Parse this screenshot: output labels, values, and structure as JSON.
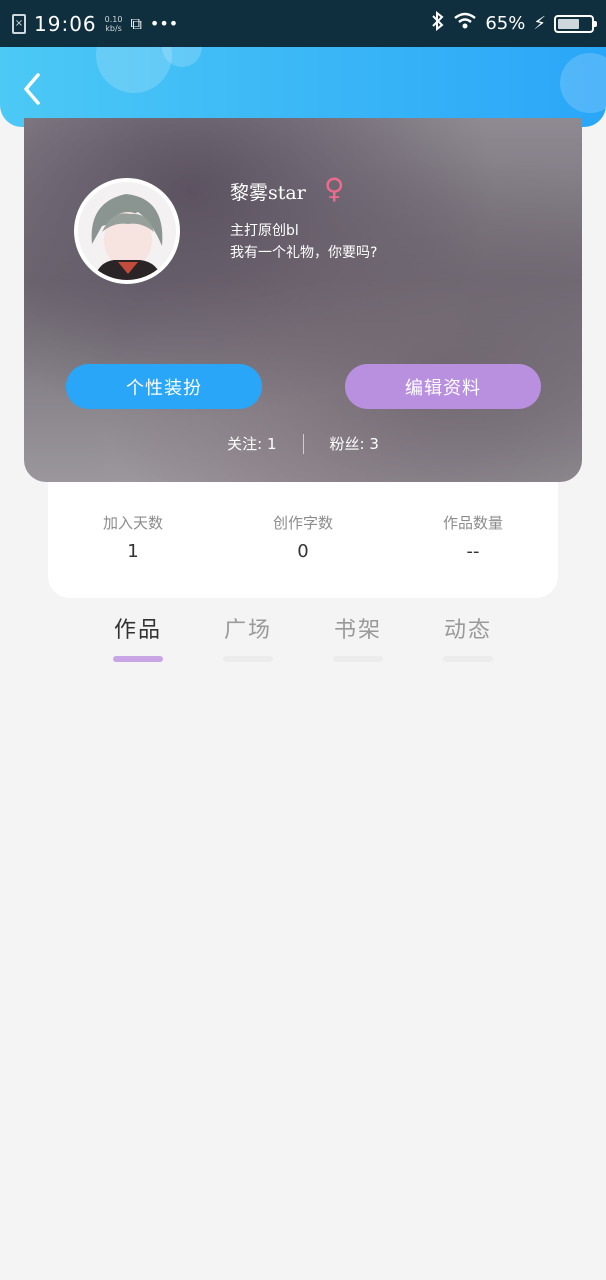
{
  "status_bar": {
    "time": "19:06",
    "speed_value": "0.10",
    "speed_unit": "kb/s",
    "battery": "65%",
    "battery_level": 0.65
  },
  "profile": {
    "username": "黎雾star",
    "gender_icon": "female-icon",
    "bio_line1": "主打原创bl",
    "bio_line2": "我有一个礼物，你要吗?",
    "dress_button": "个性装扮",
    "edit_button": "编辑资料",
    "following": "关注: 1",
    "followers": "粉丝: 3"
  },
  "stats": [
    {
      "label": "加入天数",
      "value": "1"
    },
    {
      "label": "创作字数",
      "value": "0"
    },
    {
      "label": "作品数量",
      "value": "--"
    }
  ],
  "tabs": [
    {
      "label": "作品",
      "active": true
    },
    {
      "label": "广场",
      "active": false
    },
    {
      "label": "书架",
      "active": false
    },
    {
      "label": "动态",
      "active": false
    }
  ],
  "colors": {
    "accent_blue": "#2aa6f8",
    "accent_purple": "#b98fe0",
    "gender_pink": "#f06a8c"
  }
}
